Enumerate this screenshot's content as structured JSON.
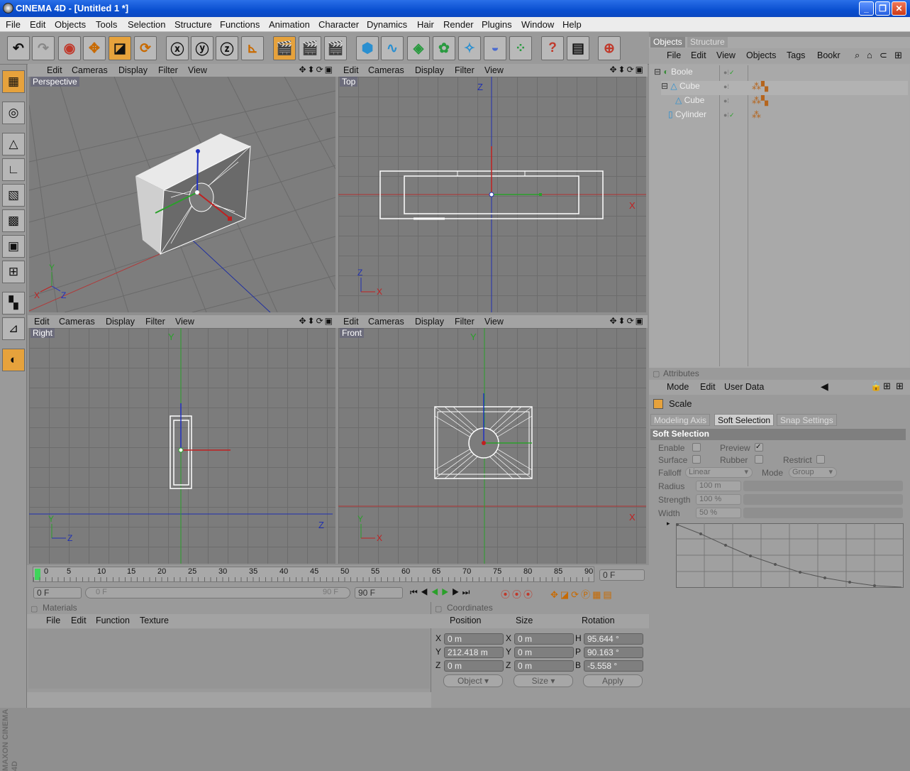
{
  "window": {
    "title": "CINEMA 4D - [Untitled 1 *]",
    "minimize": "_",
    "maximize": "❐",
    "close": "✕"
  },
  "menubar": [
    "File",
    "Edit",
    "Objects",
    "Tools",
    "Selection",
    "Structure",
    "Functions",
    "Animation",
    "Character",
    "Dynamics",
    "Hair",
    "Render",
    "Plugins",
    "Window",
    "Help"
  ],
  "viewport_menu": [
    "Edit",
    "Cameras",
    "Display",
    "Filter",
    "View"
  ],
  "viewport_controls": "✥⬍⟳▣",
  "viewports": {
    "perspective": "Perspective",
    "top": "Top",
    "right": "Right",
    "front": "Front"
  },
  "axis_labels": {
    "x": "X",
    "y": "Y",
    "z": "Z"
  },
  "objects_panel": {
    "tabs": [
      "Objects",
      "Structure"
    ],
    "menu": [
      "File",
      "Edit",
      "View",
      "Objects",
      "Tags",
      "Bookr"
    ],
    "items": [
      {
        "label": "Boole",
        "indent": 0
      },
      {
        "label": "Cube",
        "indent": 1
      },
      {
        "label": "Cube",
        "indent": 2
      },
      {
        "label": "Cylinder",
        "indent": 1
      }
    ]
  },
  "attributes_panel": {
    "title": "Attributes",
    "menu": [
      "Mode",
      "Edit",
      "User Data"
    ],
    "tool_name": "Scale",
    "tabs": [
      "Modeling Axis",
      "Soft Selection",
      "Snap Settings"
    ],
    "section": "Soft Selection",
    "enable_label": "Enable",
    "preview_label": "Preview",
    "surface_label": "Surface",
    "rubber_label": "Rubber",
    "restrict_label": "Restrict",
    "falloff_label": "Falloff",
    "falloff_value": "Linear",
    "mode_label": "Mode",
    "mode_value": "Group",
    "radius_label": "Radius",
    "radius_value": "100 m",
    "strength_label": "Strength",
    "strength_value": "100 %",
    "width_label": "Width",
    "width_value": "50 %"
  },
  "timeline": {
    "ticks": [
      "0",
      "5",
      "10",
      "15",
      "20",
      "25",
      "30",
      "35",
      "40",
      "45",
      "50",
      "55",
      "60",
      "65",
      "70",
      "75",
      "80",
      "85",
      "90"
    ],
    "current_frame": "0 F",
    "start_field": "0 F",
    "range_start": "0 F",
    "range_end": "90 F",
    "end_field": "90 F"
  },
  "materials_panel": {
    "title": "Materials",
    "menu": [
      "File",
      "Edit",
      "Function",
      "Texture"
    ]
  },
  "coordinates_panel": {
    "title": "Coordinates",
    "headers": [
      "Position",
      "Size",
      "Rotation"
    ],
    "rows": [
      {
        "axis": "X",
        "pos": "0 m",
        "size_axis": "X",
        "size": "0 m",
        "rot_axis": "H",
        "rot": "95.644 °"
      },
      {
        "axis": "Y",
        "pos": "212.418 m",
        "size_axis": "Y",
        "size": "0 m",
        "rot_axis": "P",
        "rot": "90.163 °"
      },
      {
        "axis": "Z",
        "pos": "0 m",
        "size_axis": "Z",
        "size": "0 m",
        "rot_axis": "B",
        "rot": "-5.558 °"
      }
    ],
    "object_dropdown": "Object",
    "size_dropdown": "Size",
    "apply_button": "Apply"
  },
  "branding": "MAXON CINEMA 4D",
  "colors": {
    "accent": "#e6a23c",
    "titlebar": "#0a4fd0",
    "viewport_bg": "#7c7c7c",
    "x_axis": "#c0392b",
    "y_axis": "#2ecc40",
    "z_axis": "#1f2fb0"
  }
}
